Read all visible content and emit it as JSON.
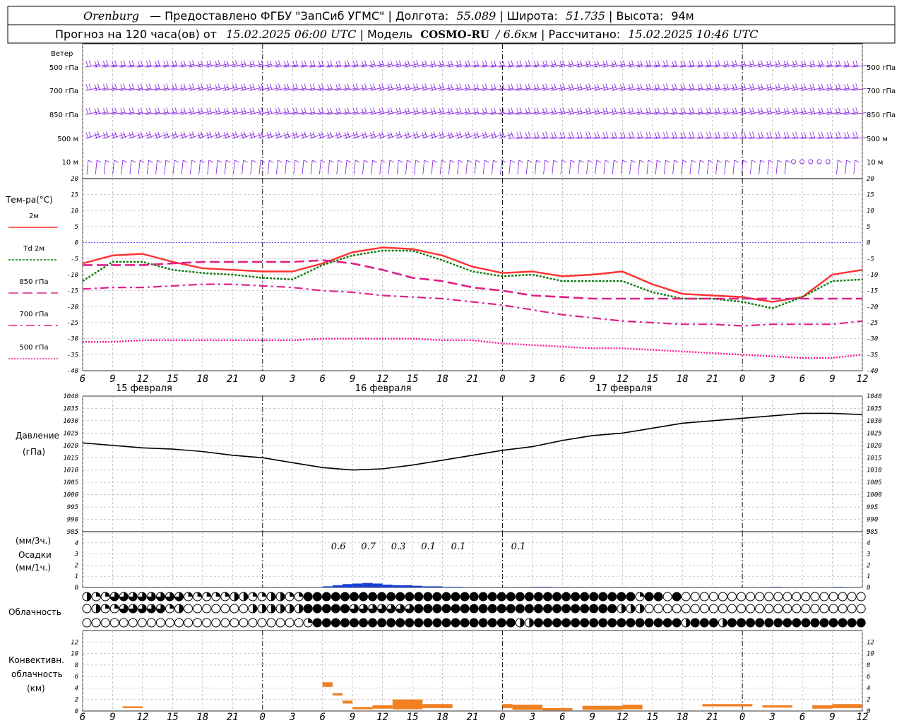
{
  "header": {
    "station": "Orenburg",
    "provider": "— Предоставлено ФГБУ \"ЗапСиб УГМС\"",
    "lon_label": "Долгота:",
    "lon_value": "55.089",
    "lat_label": "Широта:",
    "lat_value": "51.735",
    "alt_label": "Высота:",
    "alt_value": "94м",
    "forecast_label": "Прогноз на 120 часа(ов) от",
    "forecast_time": "15.02.2025 06:00 UTC",
    "model_label": "Модель",
    "model_name": "COSMO-RU",
    "model_res": "/ 6.6км",
    "calc_label": "Рассчитано:",
    "calc_time": "15.02.2025 10:46 UTC"
  },
  "wind_panel": {
    "title": "Ветер",
    "levels": [
      "500 гПа",
      "700 гПа",
      "850 гПа",
      "500 м",
      "10  м"
    ]
  },
  "colors": {
    "wind": "#8a2be2",
    "t2m": "#ff3030",
    "td2m": "#0a7a0a",
    "t850": "#e0208a",
    "t700": "#e0208a",
    "t500": "#ff1493",
    "pressure": "#000000",
    "precip": "#1a3fd8",
    "conv": "#f08020",
    "zero": "#0000ff",
    "grid": "#b0b0b0"
  },
  "time_axis": {
    "hours_ticks": [
      "6",
      "9",
      "12",
      "15",
      "18",
      "21",
      "0",
      "3",
      "6",
      "9",
      "12",
      "15",
      "18",
      "21",
      "0",
      "3",
      "6",
      "9",
      "12",
      "15",
      "18",
      "21",
      "0",
      "3",
      "6",
      "9",
      "12"
    ],
    "day_labels": [
      "15 февраля",
      "16 февраля",
      "17 февраля"
    ]
  },
  "chart_data": [
    {
      "type": "line",
      "title": "Тем-ра(°C)",
      "ylim": [
        -40,
        20
      ],
      "grid": true,
      "x": [
        "15.02 06",
        "15.02 09",
        "15.02 12",
        "15.02 15",
        "15.02 18",
        "15.02 21",
        "16.02 00",
        "16.02 03",
        "16.02 06",
        "16.02 09",
        "16.02 12",
        "16.02 15",
        "16.02 18",
        "16.02 21",
        "17.02 00",
        "17.02 03",
        "17.02 06",
        "17.02 09",
        "17.02 12",
        "17.02 15",
        "17.02 18",
        "17.02 21",
        "18.02 00",
        "18.02 03",
        "18.02 06",
        "18.02 09",
        "18.02 12"
      ],
      "series": [
        {
          "name": "2м",
          "values": [
            -6.5,
            -4,
            -3.5,
            -6,
            -8,
            -8.5,
            -9,
            -9,
            -6.5,
            -3,
            -1.5,
            -2,
            -4,
            -7.5,
            -9.5,
            -9,
            -10.5,
            -10,
            -9,
            -13,
            -16,
            -16.5,
            -17,
            -18.5,
            -17,
            -10,
            -8.5
          ]
        },
        {
          "name": "Td  2м",
          "values": [
            -12,
            -6,
            -6,
            -8.5,
            -9.5,
            -10,
            -11,
            -11.5,
            -7,
            -4,
            -2.5,
            -2.5,
            -5.5,
            -9,
            -10.5,
            -10,
            -12,
            -12,
            -12,
            -15.5,
            -17.5,
            -17.5,
            -18.5,
            -20.5,
            -17,
            -12,
            -11.5
          ]
        },
        {
          "name": "850 гПа",
          "values": [
            -7,
            -7,
            -7,
            -6.5,
            -6,
            -6,
            -6,
            -6,
            -5.5,
            -6.5,
            -8.5,
            -11,
            -12,
            -14,
            -15,
            -16.5,
            -17,
            -17.5,
            -17.5,
            -17.5,
            -17.5,
            -17.5,
            -17.5,
            -17.5,
            -17.5,
            -17.5,
            -17.5
          ]
        },
        {
          "name": "700 гПа",
          "values": [
            -14.5,
            -14,
            -14,
            -13.5,
            -13,
            -13,
            -13.5,
            -14,
            -15,
            -15.5,
            -16.5,
            -17,
            -17.5,
            -18.5,
            -19.5,
            -21,
            -22.5,
            -23.5,
            -24.5,
            -25,
            -25.5,
            -25.5,
            -26,
            -25.5,
            -25.5,
            -25.5,
            -24.5
          ]
        },
        {
          "name": "500 гПа",
          "values": [
            -31,
            -31,
            -30.5,
            -30.5,
            -30.5,
            -30.5,
            -30.5,
            -30.5,
            -30,
            -30,
            -30,
            -30,
            -30.5,
            -30.5,
            -31.5,
            -32,
            -32.5,
            -33,
            -33,
            -33.5,
            -34,
            -34.5,
            -35,
            -35.5,
            -36,
            -36,
            -35
          ]
        }
      ]
    },
    {
      "type": "line",
      "title": "Давление",
      "ylabel": "(гПа)",
      "ylim": [
        985,
        1040
      ],
      "grid": true,
      "x": [
        "15.02 06",
        "15.02 09",
        "15.02 12",
        "15.02 15",
        "15.02 18",
        "15.02 21",
        "16.02 00",
        "16.02 03",
        "16.02 06",
        "16.02 09",
        "16.02 12",
        "16.02 15",
        "16.02 18",
        "16.02 21",
        "17.02 00",
        "17.02 03",
        "17.02 06",
        "17.02 09",
        "17.02 12",
        "17.02 15",
        "17.02 18",
        "17.02 21",
        "18.02 00",
        "18.02 03",
        "18.02 06",
        "18.02 09",
        "18.02 12"
      ],
      "series": [
        {
          "values": [
            1021,
            1020,
            1019,
            1018.5,
            1017.5,
            1016,
            1015,
            1013,
            1011,
            1010,
            1010.5,
            1012,
            1014,
            1016,
            1018,
            1019.5,
            1022,
            1024,
            1025,
            1027,
            1029,
            1030,
            1031,
            1032,
            1033,
            1033,
            1032.5
          ]
        }
      ]
    },
    {
      "type": "bar",
      "title": "Осадки",
      "ylabel": "(мм/3ч.) (мм/1ч.)",
      "ylim": [
        0,
        5
      ],
      "labels": [
        {
          "x": "16.02 09",
          "text": "0.6"
        },
        {
          "x": "16.02 12",
          "text": "0.7"
        },
        {
          "x": "16.02 15",
          "text": "0.3"
        },
        {
          "x": "16.02 18",
          "text": "0.1"
        },
        {
          "x": "16.02 21",
          "text": "0.1"
        },
        {
          "x": "17.02 03",
          "text": "0.1"
        }
      ],
      "bars": [
        {
          "x": "16.02 06",
          "values": [
            0.1,
            0.2,
            0.3
          ]
        },
        {
          "x": "16.02 09",
          "values": [
            0.35,
            0.4,
            0.35
          ]
        },
        {
          "x": "16.02 12",
          "values": [
            0.25,
            0.2,
            0.2
          ]
        },
        {
          "x": "16.02 15",
          "values": [
            0.15,
            0.1,
            0.1
          ]
        },
        {
          "x": "16.02 18",
          "values": [
            0.05,
            0.05,
            0.02
          ]
        },
        {
          "x": "17.02 03",
          "values": [
            0.05,
            0.05,
            0.02
          ]
        },
        {
          "x": "18.02 03",
          "values": [
            0.05,
            0.02,
            0
          ]
        },
        {
          "x": "18.02 09",
          "values": [
            0.05,
            0.02,
            0
          ]
        }
      ]
    },
    {
      "type": "table",
      "title": "Облачность",
      "rows": [
        "hqqttttttttqqqqqhhqqhhqqFFFFFFFFFFFFFFFFFFFFFFFFFFFFFFFFFFFFqFF0F0000000000000000000000000000000000000000000000",
        "0hqqtttttqh0000000hhhhhhFFFFFtttttttFFFFFFFFFFFFFFFFFFFFFFhhh00000000000000000000000000000000000000000000000",
        "000000000000000000000000qFFFFFFFFFFFFFFFFFFFFFFhhFFFFFFFFFFFFFFFFhFFFhFFFFFFFFFFFFFFFFFFFFFFFFFFFFFFFFFFFFFFFFF"
      ]
    },
    {
      "type": "bar",
      "title": "Конвективн. облачность",
      "ylabel": "(км)",
      "ylim": [
        0,
        14
      ],
      "segments": [
        {
          "x0": "15.02 10",
          "x1": "15.02 12",
          "bottom": 0.5,
          "top": 0.8
        },
        {
          "x0": "16.02 06",
          "x1": "16.02 07",
          "bottom": 4.2,
          "top": 5.0
        },
        {
          "x0": "16.02 07",
          "x1": "16.02 08",
          "bottom": 2.7,
          "top": 3.1
        },
        {
          "x0": "16.02 08",
          "x1": "16.02 09",
          "bottom": 1.3,
          "top": 1.8
        },
        {
          "x0": "16.02 09",
          "x1": "16.02 11",
          "bottom": 0.3,
          "top": 0.7
        },
        {
          "x0": "16.02 11",
          "x1": "16.02 13",
          "bottom": 0.4,
          "top": 1.0
        },
        {
          "x0": "16.02 13",
          "x1": "16.02 16",
          "bottom": 0.3,
          "top": 2.0
        },
        {
          "x0": "16.02 16",
          "x1": "16.02 19",
          "bottom": 0.5,
          "top": 1.2
        },
        {
          "x0": "17.02 00",
          "x1": "17.02 01",
          "bottom": 0.5,
          "top": 1.2
        },
        {
          "x0": "17.02 01",
          "x1": "17.02 04",
          "bottom": 0.2,
          "top": 1.1
        },
        {
          "x0": "17.02 04",
          "x1": "17.02 07",
          "bottom": 0.1,
          "top": 0.5
        },
        {
          "x0": "17.02 08",
          "x1": "17.02 12",
          "bottom": 0.2,
          "top": 0.9
        },
        {
          "x0": "17.02 12",
          "x1": "17.02 14",
          "bottom": 0.3,
          "top": 1.1
        },
        {
          "x0": "17.02 20",
          "x1": "18.02 01",
          "bottom": 0.8,
          "top": 1.2
        },
        {
          "x0": "18.02 02",
          "x1": "18.02 05",
          "bottom": 0.6,
          "top": 1.0
        },
        {
          "x0": "18.02 07",
          "x1": "18.02 09",
          "bottom": 0.4,
          "top": 1.0
        },
        {
          "x0": "18.02 09",
          "x1": "18.02 12",
          "bottom": 0.5,
          "top": 1.2
        }
      ]
    }
  ]
}
